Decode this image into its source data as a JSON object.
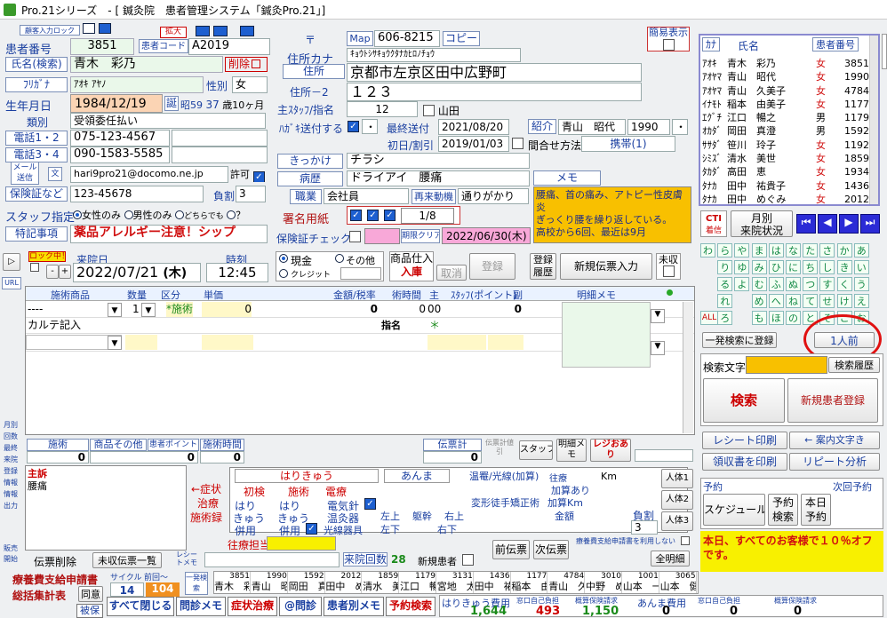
{
  "window": {
    "title": "Pro.21シリーズ　- [ 鍼灸院　患者管理システム「鍼灸Pro.21」]"
  },
  "header": {
    "lock_label": "顧客入力ロック",
    "enlarge": "拡大",
    "simple_view": "簡易表示"
  },
  "patient": {
    "number_label": "患者番号",
    "number": "3851",
    "code_label": "患者コード",
    "code": "A2019",
    "name_label": "氏名(検索)",
    "name": "青木　彩乃",
    "delete_label": "削除",
    "furigana_label": "ﾌﾘｶﾞﾅ",
    "furigana": "ｱｵｷ ｱﾔﾉ",
    "sex_label": "性別",
    "sex": "女",
    "birth_label": "生年月日",
    "birth": "1984/12/19",
    "birth_btn": "誕",
    "era": "昭59",
    "age": "37",
    "age_unit": "歳",
    "months": "10",
    "months_unit": "ヶ月",
    "category_label": "類別",
    "category": "受領委任払い",
    "tel12_label": "電話1・2",
    "tel1": "075-123-4567",
    "tel34_label": "電話3・4",
    "tel3": "090-1583-5585",
    "mail_label": "メール送信",
    "mail_btn": "文",
    "email": "hari9pro21@docomo.ne.jp",
    "permit": "許可",
    "insurance_label": "保険証など",
    "insurance": "123-45678",
    "burden_label": "負割",
    "burden": "3",
    "staff_label": "スタッフ指定",
    "staff_opt1": "女性のみ",
    "staff_opt2": "男性のみ",
    "staff_opt3": "どちらでも",
    "staff_opt4": "？",
    "notes_label": "特記事項",
    "notes": "薬品アレルギー注意！シップ"
  },
  "address": {
    "postal_symbol": "〒",
    "map": "Map",
    "postal": "606-8215",
    "copy": "コピー",
    "kana_label": "住所カナ",
    "kana": "ｷｮｳﾄｼｻｷｮｳｸﾀﾅｶﾋﾛﾉﾁｮｳ",
    "addr_label": "住所",
    "addr": "京都市左京区田中広野町",
    "addr2_label": "住所－2",
    "addr2": "１２３",
    "staff_label": "主ｽﾀｯﾌ/指名",
    "staff_no": "12",
    "staff_name": "山田",
    "postcard_label": "ﾊｶﾞｷ送付する",
    "postcard_extra": "・",
    "last_sent_label": "最終送付",
    "last_sent": "2021/08/20",
    "first_label": "初日/割引",
    "first": "2019/01/03",
    "gap_label": "間合せ方法",
    "gap": "携帯(1)",
    "intro_label": "紹介",
    "intro_name": "青山　昭代",
    "intro_no": "1990",
    "intro_dot": "・",
    "trigger_label": "きっかけ",
    "trigger": "チラシ",
    "history_label": "病歴",
    "history": "ドライアイ　腰痛",
    "job_label": "職業",
    "job": "会社員",
    "revisit": "再来動機",
    "revisit_val": "通りがかり",
    "memo_label": "メモ",
    "memo": "腰痛、首の痛み、アトピー性皮膚炎\nぎっくり腰を繰り返している。\n高校から6回、最近は9月",
    "sign_label": "署名用紙",
    "sign_count": "1/8",
    "insurance_check": "保険証チェック",
    "expiry": "期限クリア",
    "expiry_date": "2022/06/30(木)"
  },
  "patient_list": {
    "header_kana": "ｶﾅ",
    "header_name": "氏名",
    "header_num": "患者番号",
    "rows": [
      {
        "kana": "ｱｵｷ",
        "name": "青木　彩乃",
        "sex": "女",
        "num": "3851"
      },
      {
        "kana": "ｱｵﾔﾏ",
        "name": "青山　昭代",
        "sex": "女",
        "num": "1990"
      },
      {
        "kana": "ｱｵﾔﾏ",
        "name": "青山　久美子",
        "sex": "女",
        "num": "4784"
      },
      {
        "kana": "ｲﾅﾓﾄ",
        "name": "稲本　由美子",
        "sex": "女",
        "num": "1177"
      },
      {
        "kana": "ｴｸﾞﾁ",
        "name": "江口　暢之",
        "sex": "男",
        "num": "1179"
      },
      {
        "kana": "ｵｶﾀﾞ",
        "name": "岡田　真澄",
        "sex": "男",
        "num": "1592"
      },
      {
        "kana": "ｻｻﾀﾞ",
        "name": "笹川　玲子",
        "sex": "女",
        "num": "1192"
      },
      {
        "kana": "ｼﾐｽﾞ",
        "name": "清水　美世",
        "sex": "女",
        "num": "1859"
      },
      {
        "kana": "ﾀｶﾀﾞ",
        "name": "高田　恵",
        "sex": "女",
        "num": "1934"
      },
      {
        "kana": "ﾀﾅｶ",
        "name": "田中　祐貴子",
        "sex": "女",
        "num": "1436"
      },
      {
        "kana": "ﾀﾅｶ",
        "name": "田中　めぐみ",
        "sex": "女",
        "num": "2012"
      }
    ]
  },
  "nav": {
    "cti": "CTI",
    "cti2": "着信",
    "monthly": "月別",
    "monthly2": "来院状況"
  },
  "kana_grid": [
    [
      "わ",
      "ら",
      "や",
      "ま",
      "は",
      "な",
      "た",
      "さ",
      "か",
      "あ"
    ],
    [
      "",
      "り",
      "ゆ",
      "み",
      "ひ",
      "に",
      "ち",
      "し",
      "き",
      "い"
    ],
    [
      "",
      "る",
      "よ",
      "む",
      "ふ",
      "ぬ",
      "つ",
      "す",
      "く",
      "う"
    ],
    [
      "",
      "れ",
      "",
      "め",
      "へ",
      "ね",
      "て",
      "せ",
      "け",
      "え"
    ],
    [
      "ALL",
      "ろ",
      "",
      "も",
      "ほ",
      "の",
      "と",
      "そ",
      "こ",
      "お"
    ]
  ],
  "search": {
    "register": "一発検索に登録",
    "prev": "1人前",
    "text_label": "検索文字",
    "kana_search": "検索履歴",
    "search": "検索",
    "new": "新規患者登録",
    "receipt": "レシート印刷",
    "guide": "← 案内文字き",
    "invoice": "領収書を印刷",
    "repeat": "リピート分析"
  },
  "appt": {
    "label": "予約",
    "next": "次回予約",
    "schedule": "スケジュール",
    "search": "予約検索",
    "today": "本日予約",
    "notice": "本日、すべてのお客様で１０％オフです。"
  },
  "visit": {
    "lock": "ロック中！",
    "date_label": "来院日",
    "date": "2022/07/21",
    "dow": "(木)",
    "time_label": "時刻",
    "time": "12:45",
    "cash": "現金",
    "other": "その他",
    "credit": "クレジット",
    "stock": "商品仕入",
    "stock2": "入庫",
    "cancel": "取消",
    "register": "登録",
    "reg_hist": "登録履歴",
    "new_slip": "新規伝票入力",
    "unpaid": "未収"
  },
  "grid": {
    "headers": [
      "施術商品",
      "数量",
      "区分",
      "単価",
      "金額/税率",
      "術時間",
      "主",
      "ｽﾀｯﾌ(ポイント)",
      "副",
      "明細メモ"
    ],
    "row1": {
      "item": "----",
      "qty": "1",
      "cat": "*施術",
      "price": "0",
      "amount": "0",
      "mins": "0",
      "main": "00",
      "pts": "0"
    },
    "karte": "カルテ記入",
    "shimei": "指名",
    "ast": "＊"
  },
  "totals": {
    "treat": "施術",
    "product": "商品その他",
    "points": "患者ポイント",
    "time": "施術時間",
    "treat_v": "0",
    "product_v": "0",
    "time_v": "0",
    "slip_total": "伝票計",
    "slip_v": "0",
    "discount": "伝票計値引",
    "staff": "スタッフ",
    "detail": "明細メモ",
    "register": "レジおあり"
  },
  "shuso": {
    "label": "主訴",
    "text": "腰痛",
    "symptom": "←症状",
    "chiryo": "治療",
    "jutsu": "施術録"
  },
  "harikyu": {
    "title": "はりきゅう",
    "first": "初検",
    "treat": "施術",
    "electro": "電療",
    "hari": "はり",
    "kyu": "きゅう",
    "combo": "併用",
    "electric": "電気針",
    "warm": "温灸器",
    "light": "光線器具",
    "anma": "あんま",
    "onpu": "温罨/光線(加算)",
    "henkei": "変形徒手矯正術",
    "fuka": "往療",
    "kasan": "加算あり",
    "kasankm": "加算Km",
    "kingaku": "金額",
    "km": "Km",
    "burden": "負割",
    "burden_v": "3",
    "upper_left": "左上",
    "shin": "躯幹",
    "upper_right": "右上",
    "lower_left": "左下",
    "lower_right": "右下",
    "body1": "人体1",
    "body2": "人体2",
    "body3": "人体3"
  },
  "bottom": {
    "slip_delete": "伝票削除",
    "unpaid_list": "未収伝票一覧",
    "receipt_memo": "レシートメモ",
    "staff": "往療担当",
    "visits": "来院回数",
    "visits_v": "28",
    "new_patient": "新規患者",
    "prev_slip": "前伝票",
    "next_slip": "次伝票",
    "uses": "療養費支給申請書を利用しない",
    "all": "全明細",
    "req1": "療養費支給申請書",
    "req2": "総括集計表",
    "agree": "同意",
    "cycle": "サイクル",
    "cycle2": "前回～",
    "cycle_a": "14",
    "cycle_b": "104",
    "one": "一発検索",
    "close": "すべて閉じる",
    "monshin": "問診メモ",
    "symptom": "症状治療",
    "web": "@問診",
    "by_patient": "患者別メモ",
    "reserve": "予約検索",
    "insured": "被保",
    "fee1": "はりきゅう費用",
    "fee1_v": "1,644",
    "self1": "窓口自己負担",
    "self1_v": "493",
    "ins1": "概算保険請求",
    "ins1_v": "1,150",
    "fee2": "あんま費用",
    "fee2_v": "0",
    "self2": "窓口自己負担",
    "self2_v": "0",
    "ins2": "概算保険請求",
    "ins2_v": "0"
  },
  "quick": [
    {
      "num": "3851",
      "name": "青木　彩乃"
    },
    {
      "num": "1990",
      "name": "青山　昭代"
    },
    {
      "num": "1592",
      "name": "岡田　真澄"
    },
    {
      "num": "2012",
      "name": "田中　めぐみ"
    },
    {
      "num": "1859",
      "name": "清水　美世"
    },
    {
      "num": "1179",
      "name": "江口　暢之"
    },
    {
      "num": "3131",
      "name": "宮地　太郎"
    },
    {
      "num": "1436",
      "name": "田中　祐貴子"
    },
    {
      "num": "1177",
      "name": "稲本　由美子"
    },
    {
      "num": "4784",
      "name": "青山　久美子"
    },
    {
      "num": "3010",
      "name": "中野　めぐみ"
    },
    {
      "num": "1001",
      "name": "山本　一郎"
    },
    {
      "num": "3065",
      "name": "山本　健"
    }
  ],
  "side": {
    "monthly": "月別",
    "counts": "回数",
    "last": "最終",
    "visit": "来院",
    "reg": "登録",
    "info": "情報",
    "info2": "情報",
    "out": "出力",
    "ren": "販売",
    "start": "開始",
    "url": "URL"
  }
}
